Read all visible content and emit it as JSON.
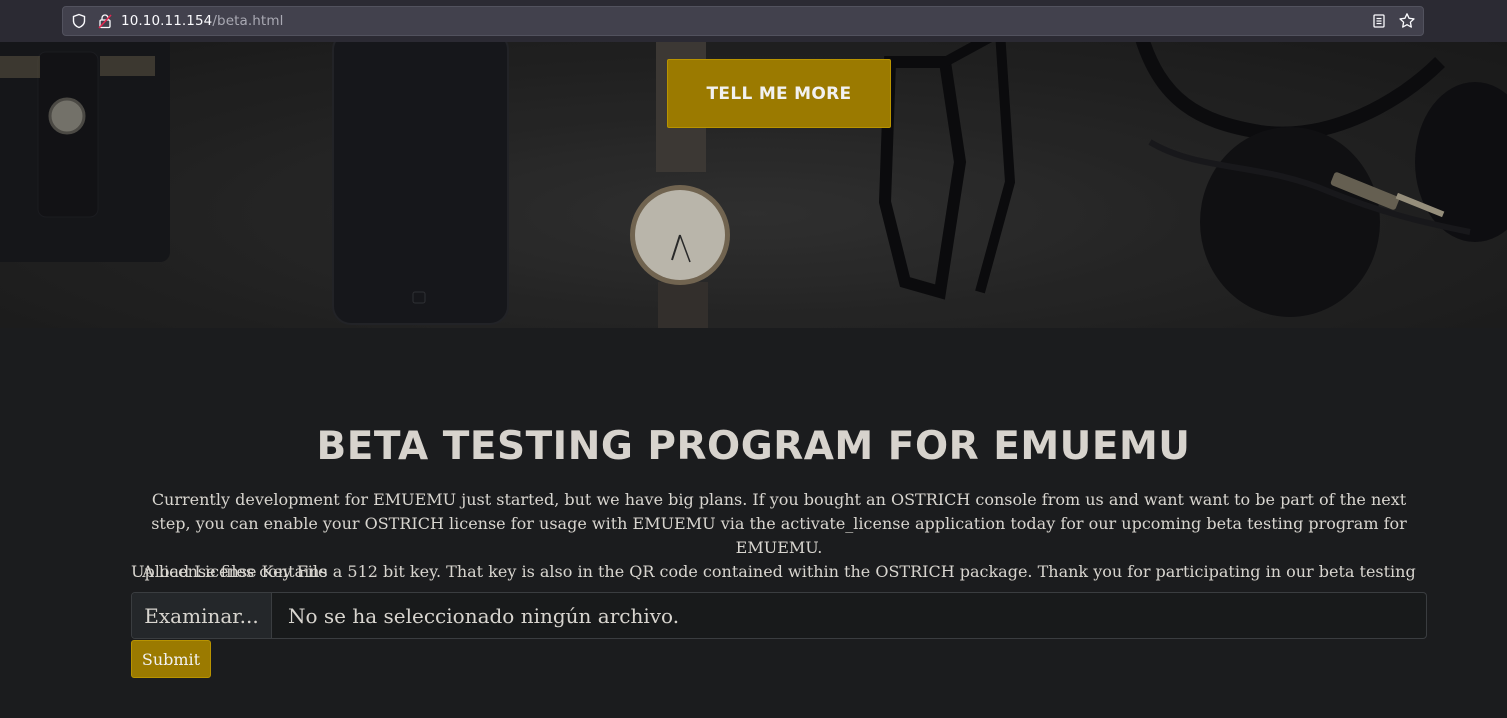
{
  "browser": {
    "url_host": "10.10.11.154",
    "url_path": "/beta.html"
  },
  "hero": {
    "cta_label": "TELL ME MORE"
  },
  "main": {
    "title": "BETA TESTING PROGRAM FOR EMUEMU",
    "description_line1": "Currently development for EMUEMU just started, but we have big plans. If you bought an OSTRICH console from us and want want to be part of the next step, you can enable your OSTRICH license for usage with EMUEMU via the activate_license application today for our upcoming beta testing program for EMUEMU.",
    "description_line2": "A license files contains a 512 bit key. That key is also in the QR code contained within the OSTRICH package. Thank you for participating in our beta testing program.",
    "upload_label": "Upload License Key File",
    "browse_label": "Examinar...",
    "file_status": "No se ha seleccionado ningún archivo.",
    "submit_label": "Submit"
  },
  "colors": {
    "accent": "#9b7a00",
    "background": "#1b1c1e",
    "text": "#d8d5cf"
  },
  "icons": {
    "shield": "shield-icon",
    "lock": "insecure-lock-icon",
    "reader": "reader-view-icon",
    "bookmark": "bookmark-star-icon"
  }
}
